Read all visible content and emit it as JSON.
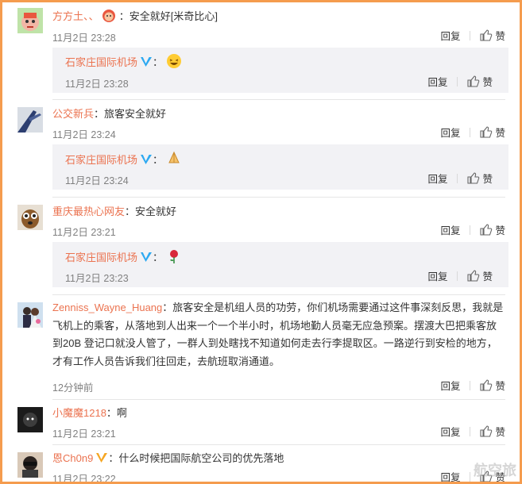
{
  "colors": {
    "border": "#f59c4e",
    "username": "#eb7350",
    "reply_bg": "#f2f2f5",
    "verified": "#2da9f1",
    "crown": "#f5a623"
  },
  "actions": {
    "reply_label": "回复",
    "like_label": "赞"
  },
  "comments": [
    {
      "user": "方方土、、",
      "badge_icon": "monkey-face-icon",
      "text": "：安全就好[米奇比心]",
      "time": "11月2日 23:28",
      "reply": {
        "user": "石家庄国际机场",
        "text": "：",
        "emoji_icon": "laughing-face-icon",
        "time": "11月2日 23:28"
      }
    },
    {
      "user": "公交新兵",
      "text": "：旅客安全就好",
      "time": "11月2日 23:24",
      "reply": {
        "user": "石家庄国际机场",
        "text": "：",
        "emoji_icon": "praying-hands-icon",
        "time": "11月2日 23:24"
      }
    },
    {
      "user": "重庆最热心网友",
      "text": "：安全就好",
      "time": "11月2日 23:21",
      "reply": {
        "user": "石家庄国际机场",
        "text": "：",
        "emoji_icon": "rose-icon",
        "time": "11月2日 23:23"
      }
    },
    {
      "user": "Zenniss_Wayne_Huang",
      "text": "：旅客安全是机组人员的功劳，你们机场需要通过这件事深刻反思，我就是飞机上的乘客，从落地到人出来一个一个半小时，机场地勤人员毫无应急预案。摆渡大巴把乘客放到20B 登记口就没人管了，一群人到处瞎找不知道如何走去行李提取区。一路逆行到安检的地方，才有工作人员告诉我们往回走，去航班取消通道。",
      "time": "12分钟前"
    },
    {
      "user": "小魔魔1218",
      "text": "：啊",
      "time": "11月2日 23:21"
    },
    {
      "user": "恩Ch0n9",
      "text": "：什么时候把国际航空公司的优先落地",
      "time": "11月2日 23:22"
    }
  ],
  "watermark": "航空旅"
}
